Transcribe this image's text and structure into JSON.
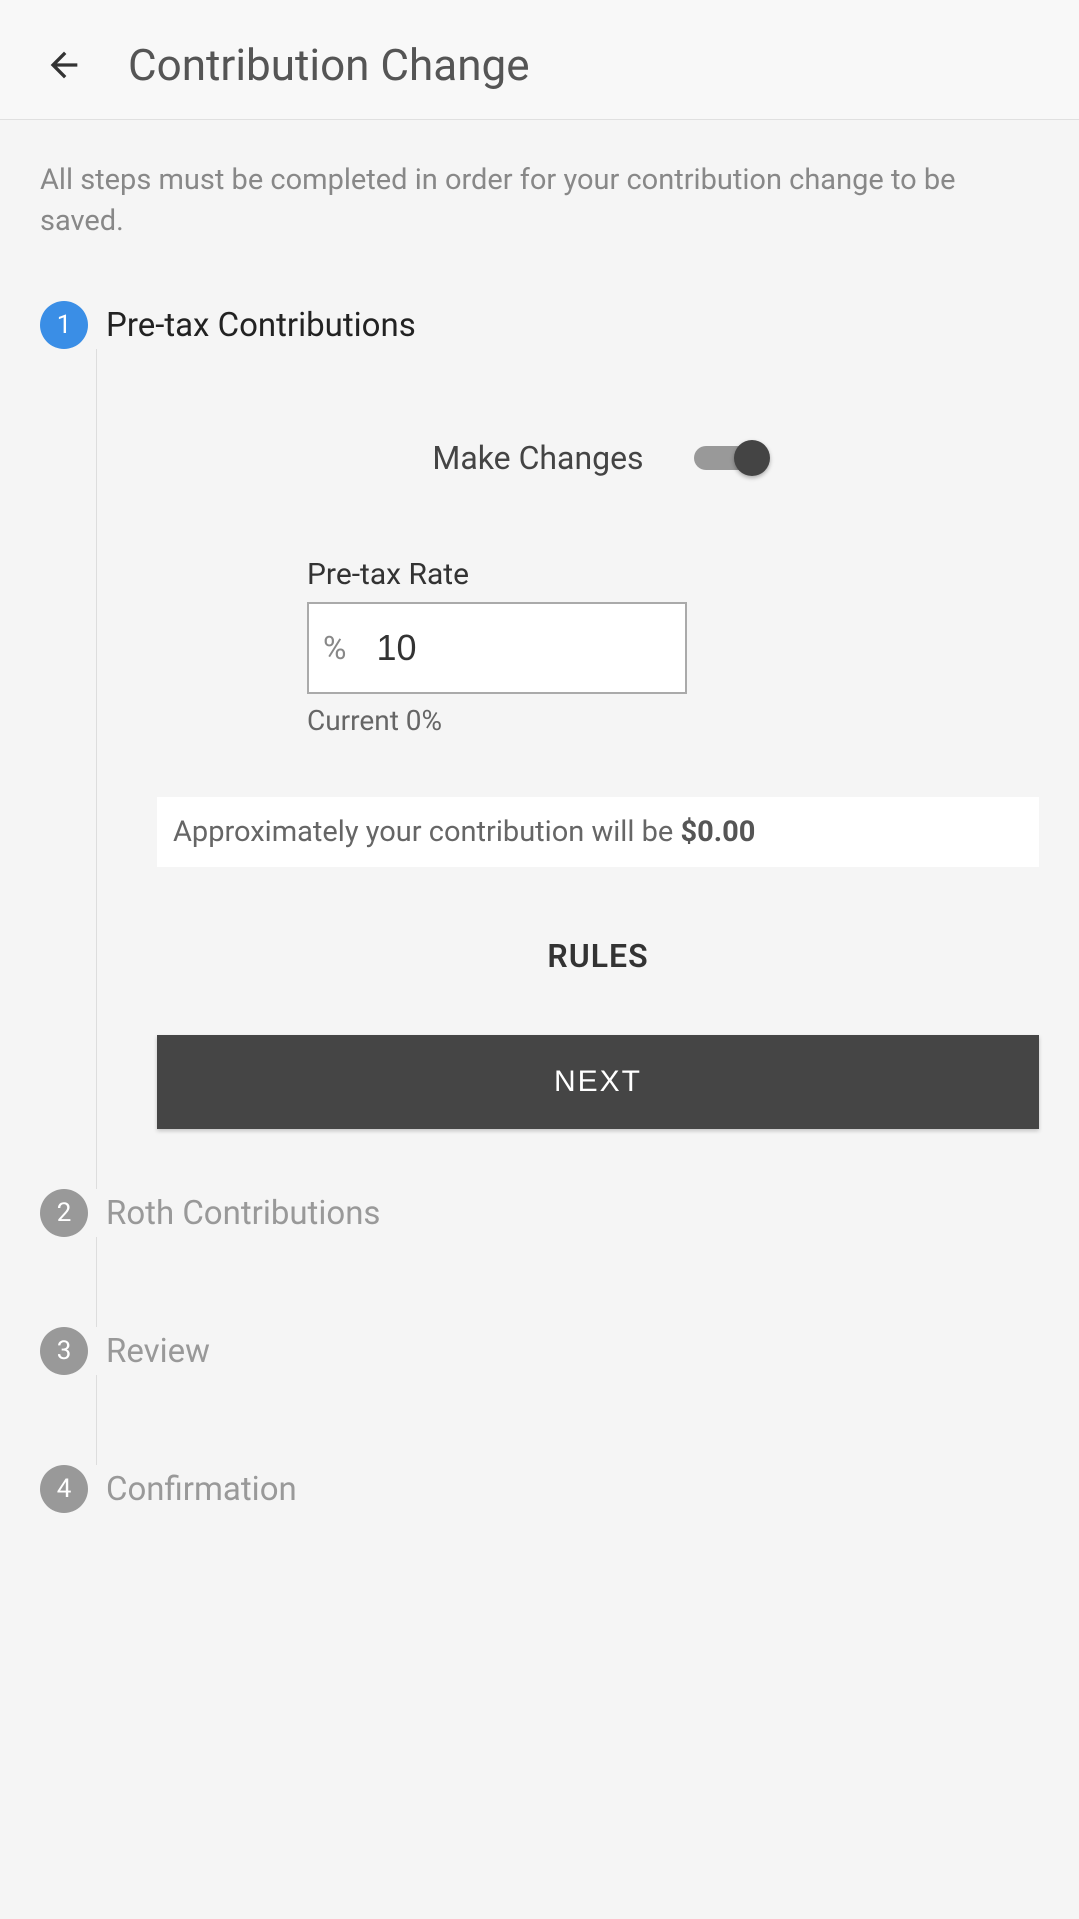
{
  "header": {
    "title": "Contribution Change"
  },
  "instructions": "All steps must be completed in order for your contribution change to be saved.",
  "steps": [
    {
      "num": "1",
      "title": "Pre-tax Contributions",
      "active": true
    },
    {
      "num": "2",
      "title": "Roth Contributions",
      "active": false
    },
    {
      "num": "3",
      "title": "Review",
      "active": false
    },
    {
      "num": "4",
      "title": "Confirmation",
      "active": false
    }
  ],
  "form": {
    "toggle_label": "Make Changes",
    "toggle_on": true,
    "rate_label": "Pre-tax Rate",
    "rate_prefix": "%",
    "rate_value": "10",
    "rate_current": "Current 0%",
    "estimate_prefix": "Approximately your contribution will be ",
    "estimate_amount": "$0.00",
    "rules_label": "RULES",
    "next_label": "NEXT"
  }
}
